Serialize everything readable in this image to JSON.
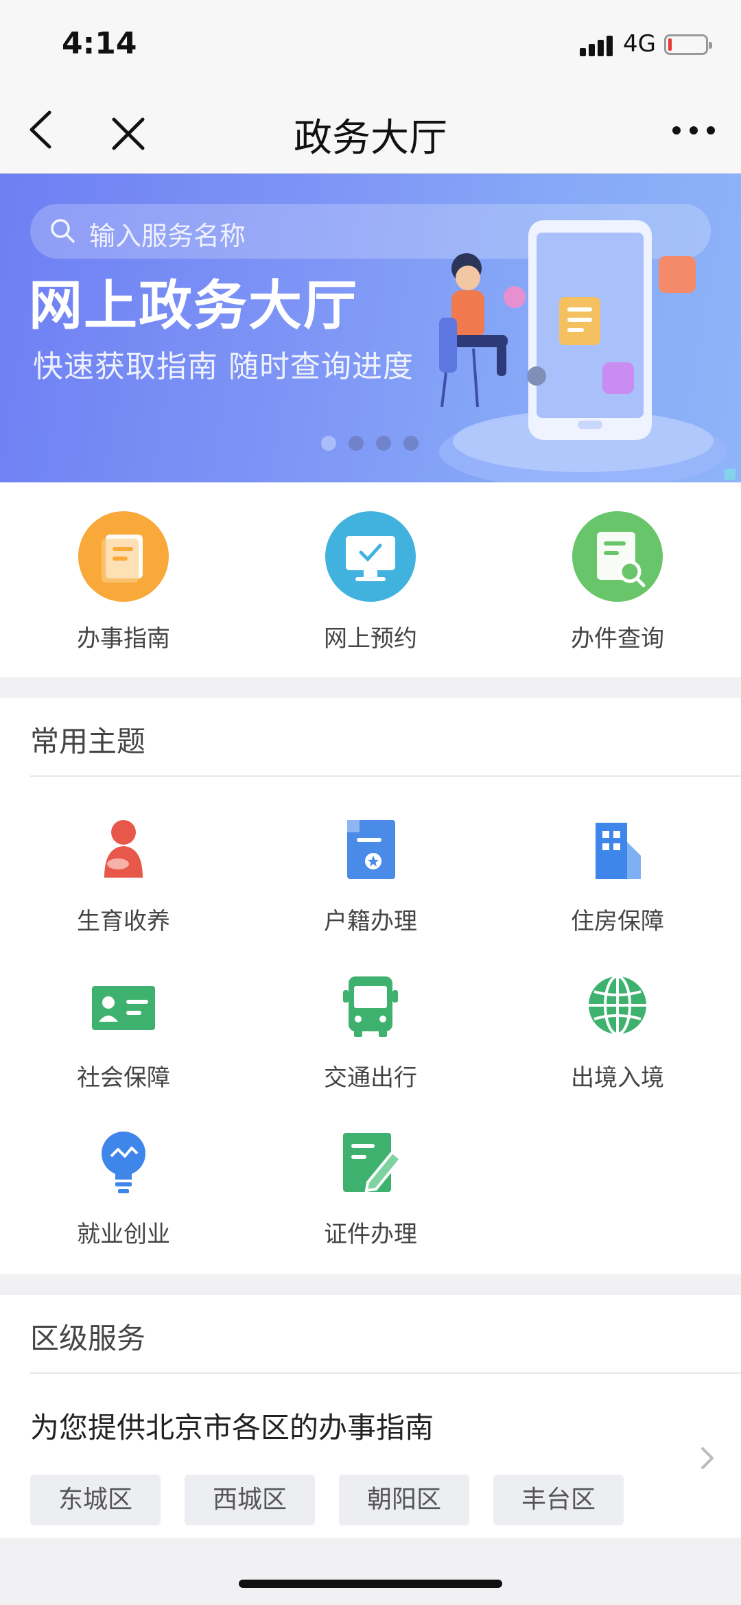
{
  "status": {
    "time": "4:14",
    "network": "4G"
  },
  "nav": {
    "title": "政务大厅"
  },
  "banner": {
    "search_placeholder": "输入服务名称",
    "headline": "网上政务大厅",
    "subline": "快速获取指南  随时查询进度",
    "page_count": 4,
    "active_page": 1
  },
  "quick_actions": [
    {
      "label": "办事指南",
      "icon": "document-guide-icon",
      "color": "#f8a93a"
    },
    {
      "label": "网上预约",
      "icon": "monitor-check-icon",
      "color": "#41b2de"
    },
    {
      "label": "办件查询",
      "icon": "document-search-icon",
      "color": "#69c56a"
    }
  ],
  "topics": {
    "title": "常用主题",
    "items": [
      {
        "label": "生育收养",
        "icon": "mother-baby-icon",
        "color": "#e8584a"
      },
      {
        "label": "户籍办理",
        "icon": "household-register-icon",
        "color": "#4a8be8"
      },
      {
        "label": "住房保障",
        "icon": "building-icon",
        "color": "#3f86ea"
      },
      {
        "label": "社会保障",
        "icon": "id-card-icon",
        "color": "#3fb16e"
      },
      {
        "label": "交通出行",
        "icon": "bus-icon",
        "color": "#3fb16e"
      },
      {
        "label": "出境入境",
        "icon": "globe-icon",
        "color": "#3fb16e"
      },
      {
        "label": "就业创业",
        "icon": "lightbulb-icon",
        "color": "#3f86ea"
      },
      {
        "label": "证件办理",
        "icon": "document-edit-icon",
        "color": "#3fb16e"
      }
    ]
  },
  "district": {
    "title": "区级服务",
    "description": "为您提供北京市各区的办事指南",
    "chips": [
      "东城区",
      "西城区",
      "朝阳区",
      "丰台区"
    ]
  }
}
